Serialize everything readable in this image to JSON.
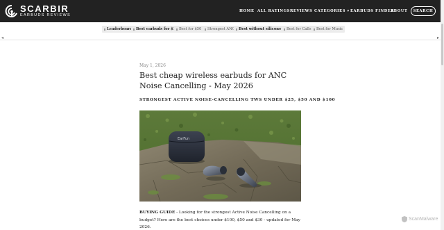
{
  "header": {
    "logo_title": "SCARBIR",
    "logo_subtitle": "EARBUDS REVIEWS",
    "nav": [
      {
        "label": "HOME"
      },
      {
        "label": "ALL RATINGS"
      },
      {
        "label": "REVIEWS"
      },
      {
        "label": "CATEGORIES ▾"
      },
      {
        "label": "EARBUDS FINDER"
      },
      {
        "label": "ABOUT"
      }
    ],
    "search_label": "SEARCH"
  },
  "tags": [
    {
      "label": "Leaderboard",
      "bold": true
    },
    {
      "label": "Best earbuds for $100",
      "bold": true
    },
    {
      "label": "Best for $50",
      "bold": false
    },
    {
      "label": "Strongest ANC",
      "bold": false
    },
    {
      "label": "Best without silicone tips",
      "bold": true
    },
    {
      "label": "Best for Calls",
      "bold": false
    },
    {
      "label": "Best for Music",
      "bold": false
    }
  ],
  "article": {
    "date": "May 1, 2026",
    "title": "Best cheap wireless earbuds for ANC Noise Cancelling - May 2026",
    "subtitle": "STRONGEST ACTIVE NOISE-CANCELLING TWS UNDER $25, $50 AND $100",
    "image_alt": "Wireless earbuds case and earbuds on a stone slab on grass",
    "case_brand": "EarFun",
    "intro_bold": "BUYING GUIDE",
    "intro_text": " - Looking for the strongest Active Noise Cancelling on a budget? Here are the best choices under $100, $50 and $30 - updated for May 2026."
  },
  "watermark": "ScanMalware",
  "colors": {
    "header_bg": "#222222",
    "tag_bg": "#ececec",
    "text": "#222222",
    "muted": "#8a8a8a"
  }
}
